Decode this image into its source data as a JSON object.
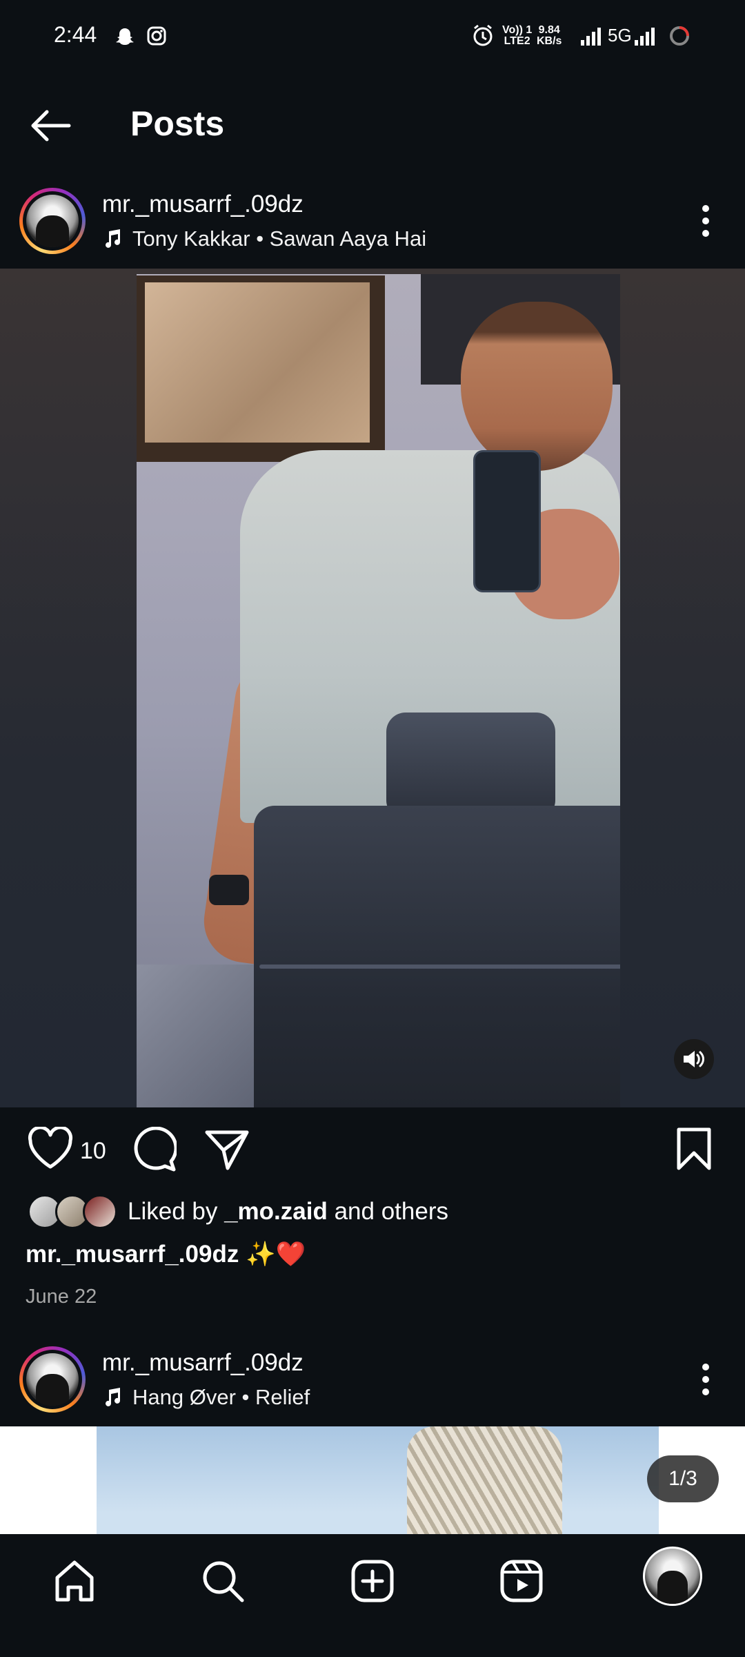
{
  "status_bar": {
    "time": "2:44",
    "network_top": "Vo)) 1",
    "network_bottom": "LTE2",
    "speed_top": "9.84",
    "speed_bottom": "KB/s",
    "network_type": "5G"
  },
  "header": {
    "title": "Posts"
  },
  "posts": [
    {
      "username": "mr._musarrf_.09dz",
      "music": "Tony Kakkar • Sawan Aaya Hai",
      "like_count": "10",
      "liked_by_prefix": "Liked by ",
      "liked_by_user": "_mo.zaid",
      "liked_by_suffix": " and others",
      "caption_user": "mr._musarrf_.09dz",
      "caption_text": " ✨❤️",
      "date": "June 22"
    },
    {
      "username": "mr._musarrf_.09dz",
      "music": "Hang Øver • Relief",
      "carousel_counter": "1/3"
    }
  ],
  "bottom_nav": {
    "items": [
      "home-icon",
      "search-icon",
      "create-icon",
      "reels-icon",
      "profile-avatar"
    ]
  },
  "colors": {
    "background": "#0c1014",
    "text_primary": "#ffffff",
    "text_secondary": "#a8a8a8"
  }
}
